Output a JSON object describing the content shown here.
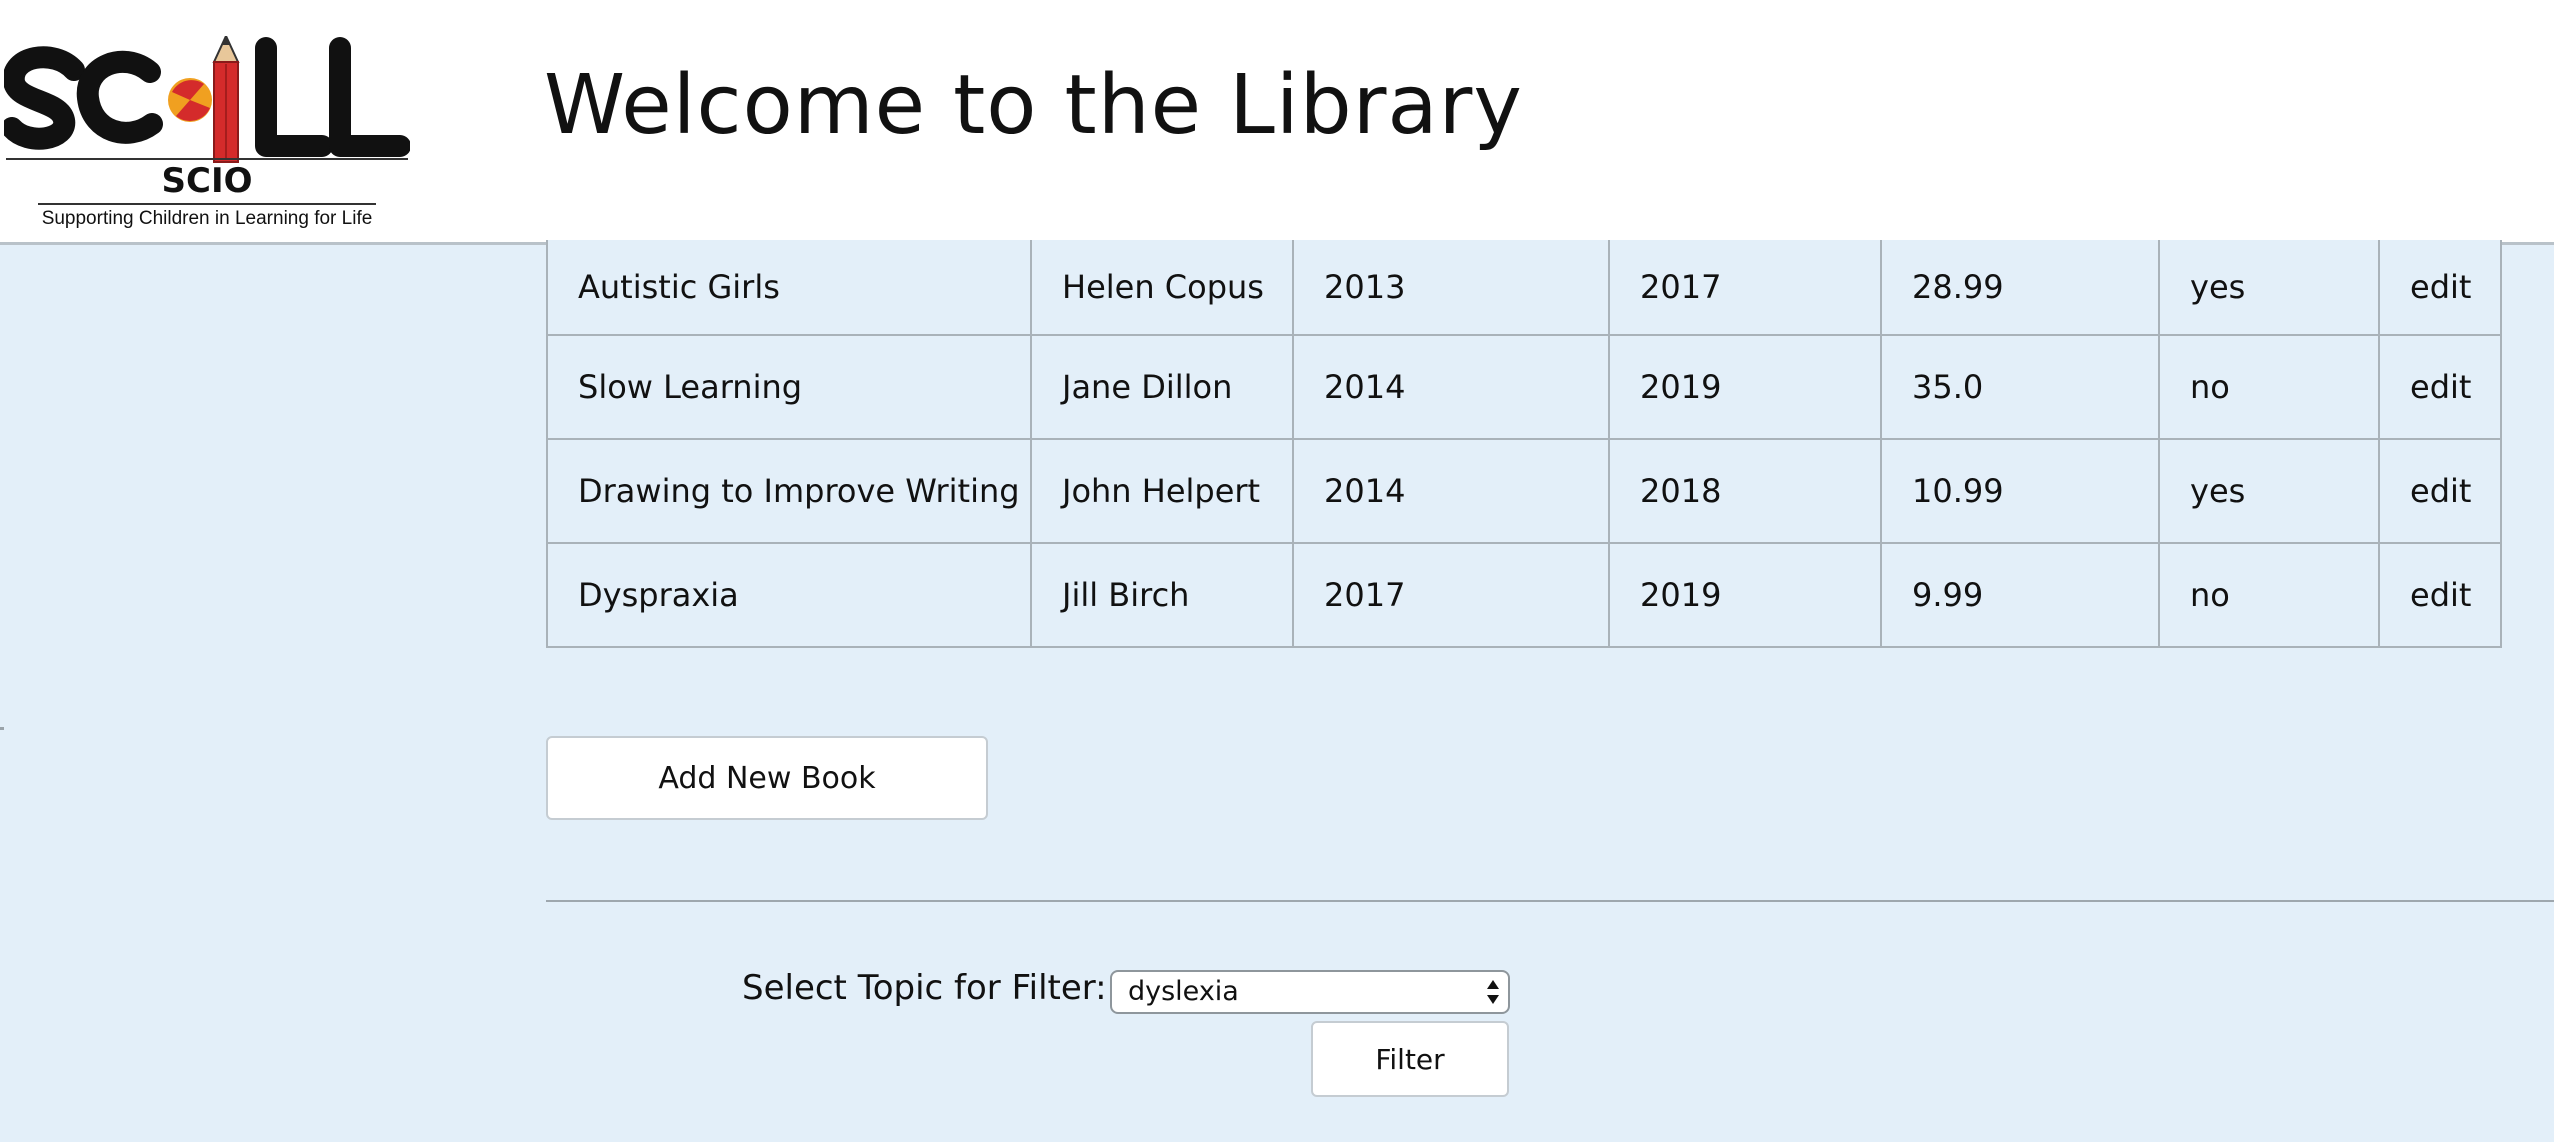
{
  "header": {
    "title": "Welcome to the Library",
    "logo": {
      "wordmark": "SCILL",
      "subtitle": "SCIO",
      "tagline": "Supporting Children in Learning for Life"
    }
  },
  "books": {
    "rows": [
      {
        "title": "Autistic Girls",
        "author": "Helen Copus",
        "col3": "2013",
        "col4": "2017",
        "price": "28.99",
        "flag": "yes",
        "action": "edit"
      },
      {
        "title": "Slow Learning",
        "author": "Jane Dillon",
        "col3": "2014",
        "col4": "2019",
        "price": "35.0",
        "flag": "no",
        "action": "edit"
      },
      {
        "title": "Drawing to Improve Writing",
        "author": "John Helpert",
        "col3": "2014",
        "col4": "2018",
        "price": "10.99",
        "flag": "yes",
        "action": "edit"
      },
      {
        "title": "Dyspraxia",
        "author": "Jill Birch",
        "col3": "2017",
        "col4": "2019",
        "price": "9.99",
        "flag": "no",
        "action": "edit"
      }
    ]
  },
  "actions": {
    "add_book_label": "Add New Book"
  },
  "filter": {
    "label": "Select Topic for Filter:",
    "selected_topic": "dyslexia",
    "button_label": "Filter"
  },
  "colors": {
    "page_background": "#e3eff9",
    "header_background": "#ffffff",
    "pencil_red": "#d42b2b",
    "ball_orange": "#f0a020"
  }
}
